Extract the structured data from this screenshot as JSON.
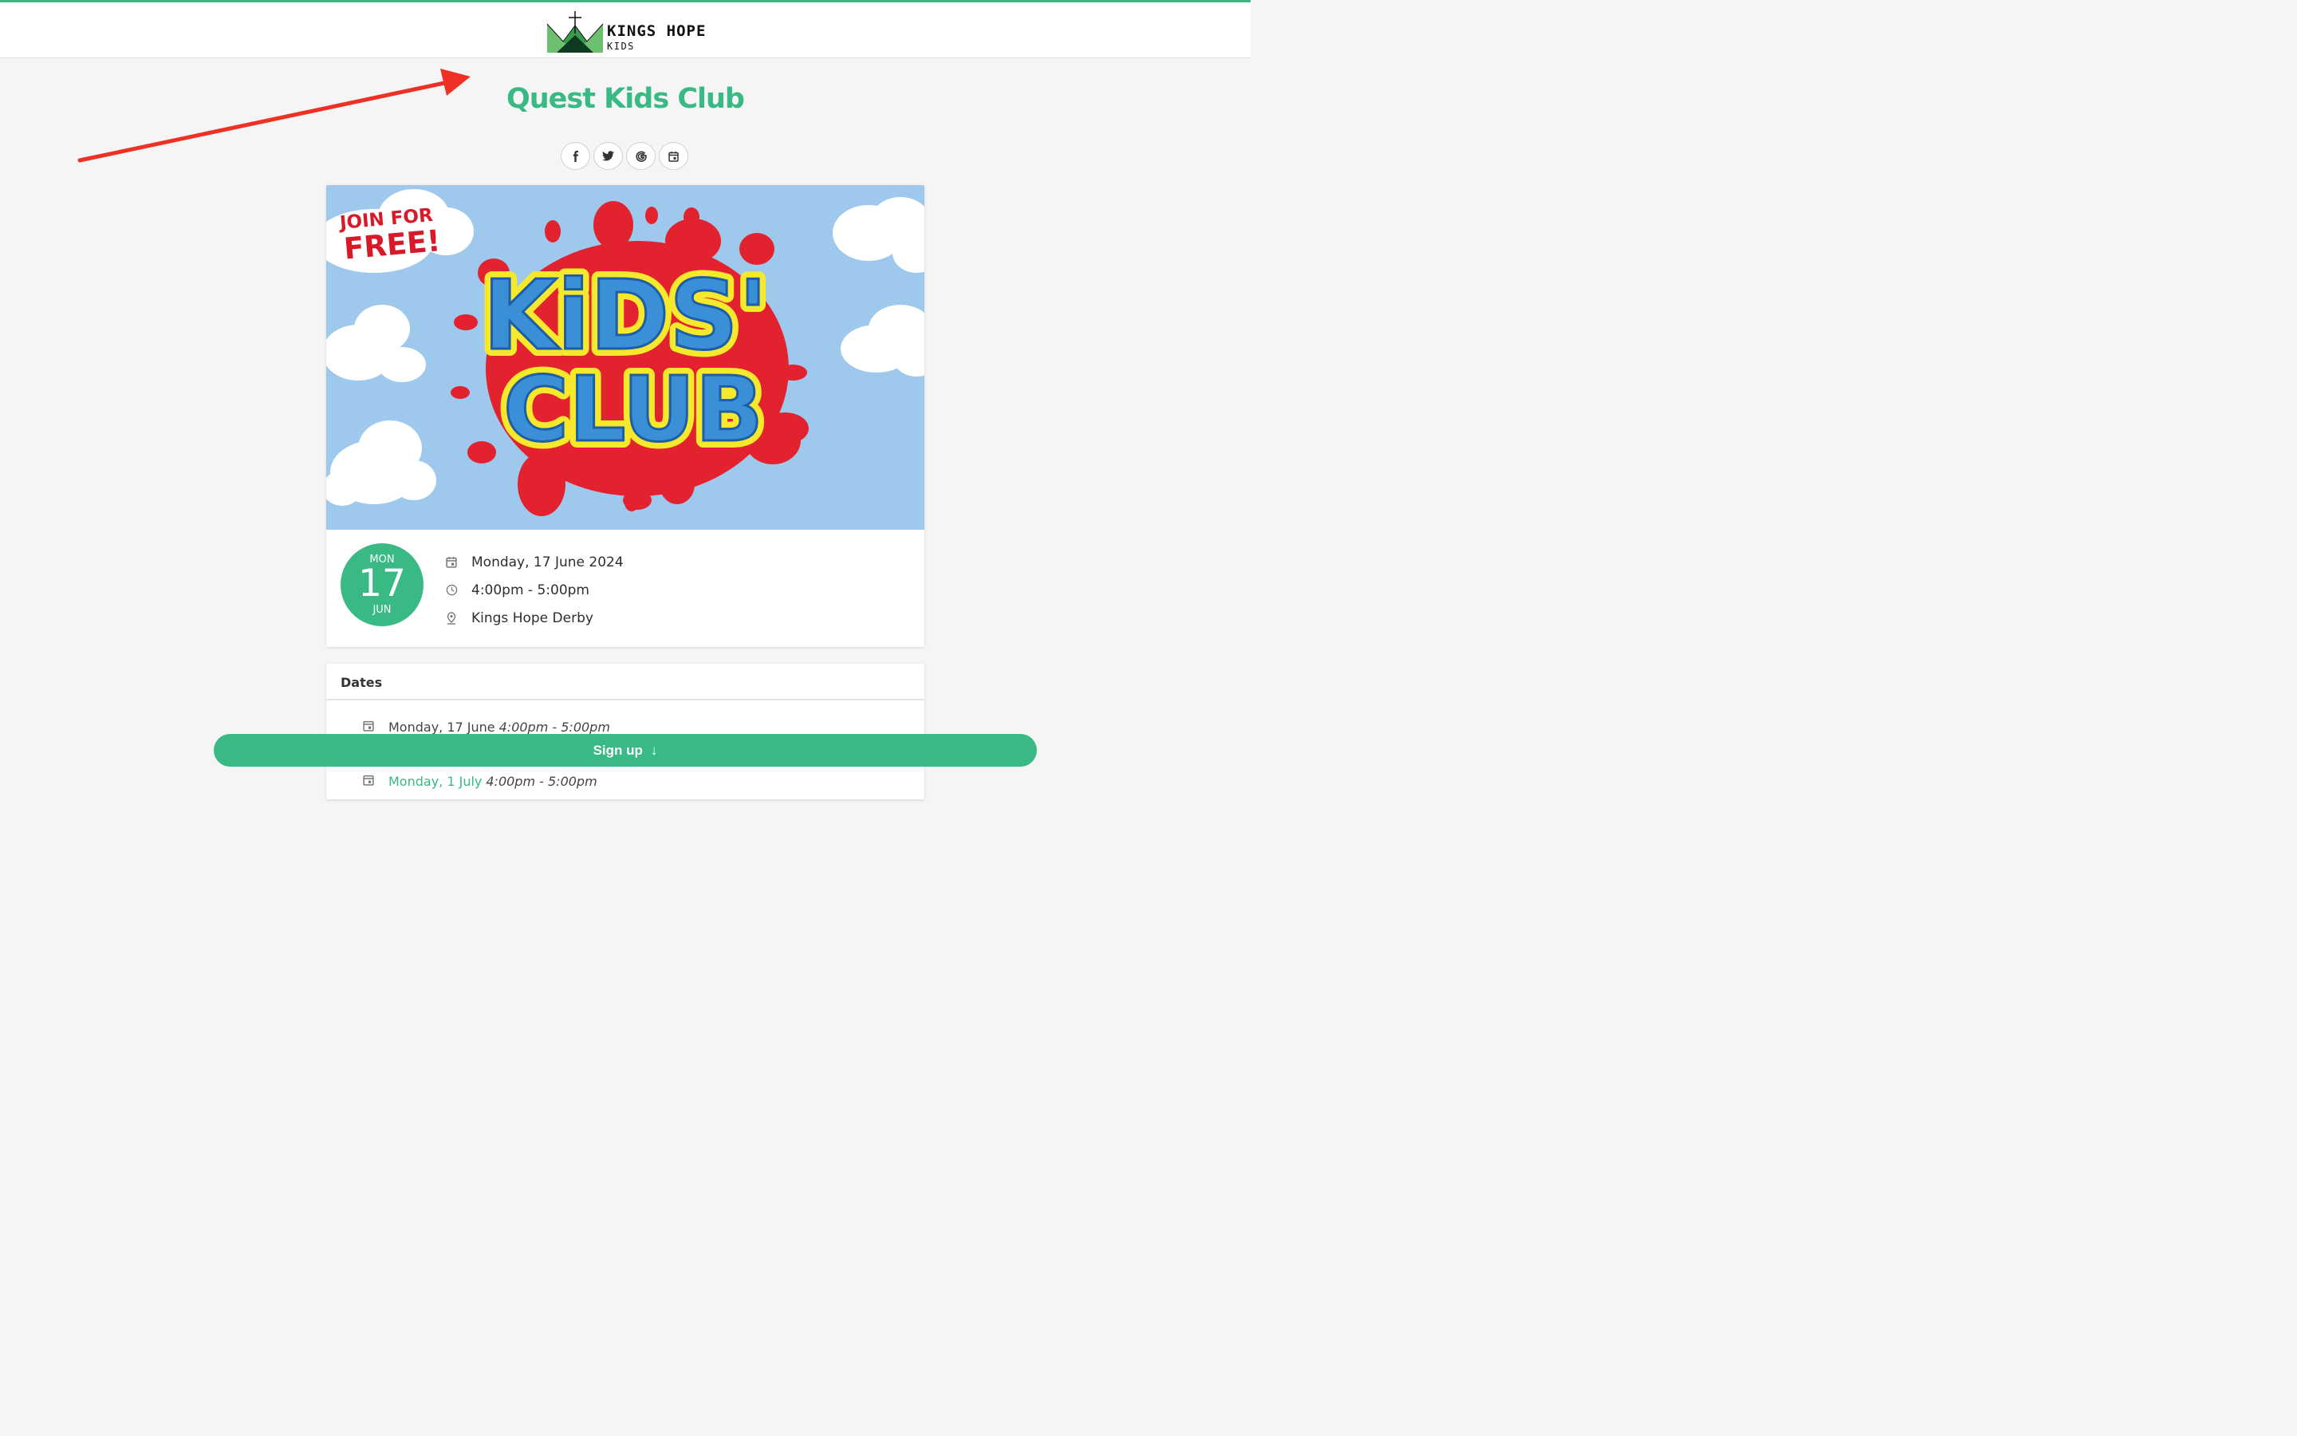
{
  "header": {
    "logo_name": "KINGS HOPE",
    "logo_sub": "KIDS"
  },
  "page": {
    "title": "Quest Kids Club"
  },
  "share": {
    "icons": [
      "facebook-icon",
      "twitter-icon",
      "google-icon",
      "calendar-icon"
    ]
  },
  "banner": {
    "join_line1": "JOIN FOR",
    "join_line2": "FREE!",
    "headline1": "KiDS'",
    "headline2": "CLUB"
  },
  "event": {
    "badge_dow": "MON",
    "badge_day": "17",
    "badge_month": "JUN",
    "date": "Monday, 17 June 2024",
    "time": "4:00pm - 5:00pm",
    "location": "Kings Hope Derby"
  },
  "dates": {
    "heading": "Dates",
    "items": [
      {
        "date": "Monday, 17 June",
        "time": "4:00pm - 5:00pm"
      },
      {
        "date": "Monday, 1 July",
        "time": "4:00pm - 5:00pm"
      }
    ]
  },
  "signup": {
    "label": "Sign up",
    "arrow": "↓"
  },
  "colors": {
    "accent": "#39b983",
    "annotation_arrow": "#ee3124",
    "banner_sky": "#9ec9ec"
  }
}
